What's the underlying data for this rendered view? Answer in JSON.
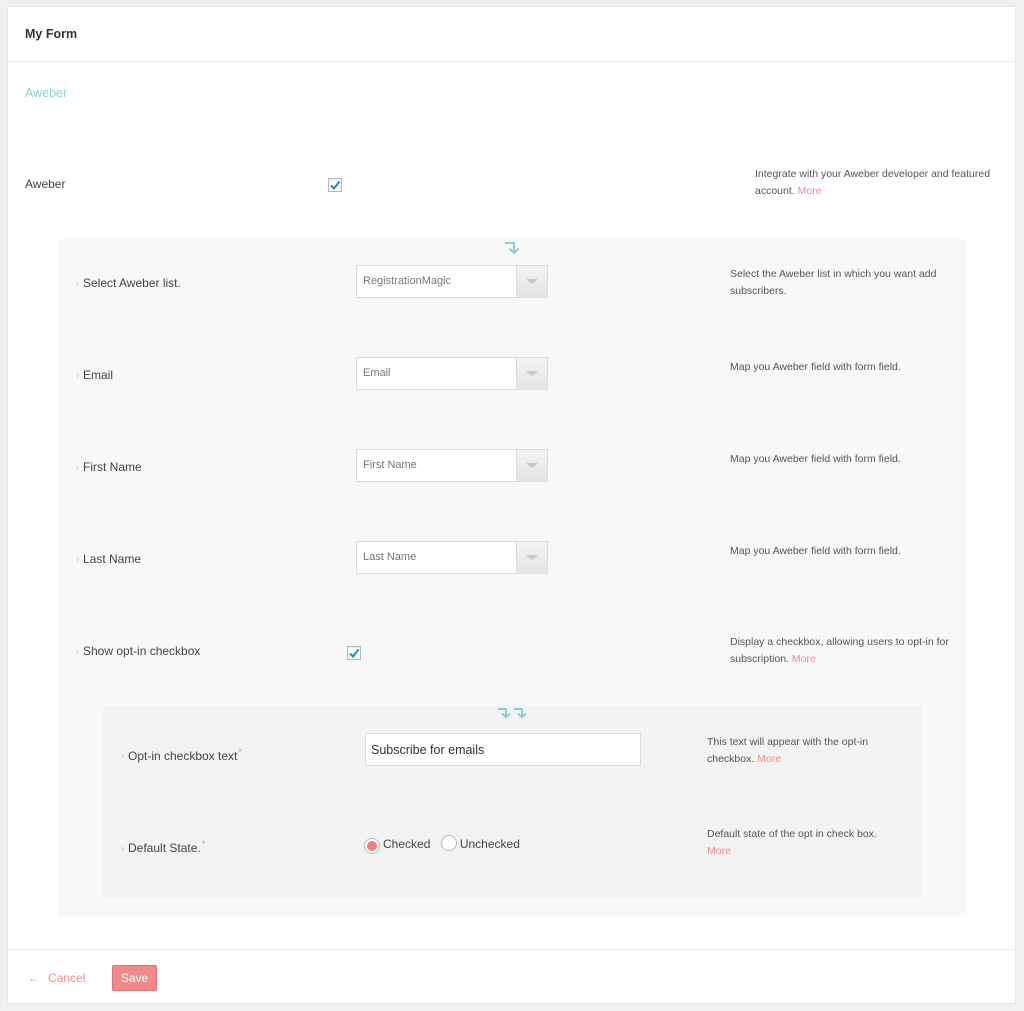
{
  "header": {
    "title": "My Form"
  },
  "section": {
    "title": "Aweber"
  },
  "aweber_toggle": {
    "label": "Aweber",
    "checked": true,
    "help": "Integrate with your Aweber developer and featured account.",
    "more": "More"
  },
  "fields": [
    {
      "label": "Select Aweber list.",
      "value": "RegistrationMagic",
      "help": "Select the Aweber list in which you want add subscribers."
    },
    {
      "label": "Email",
      "value": "Email",
      "help": "Map you Aweber field with form field."
    },
    {
      "label": "First Name",
      "value": "First Name",
      "help": "Map you Aweber field with form field."
    },
    {
      "label": "Last Name",
      "value": "Last Name",
      "help": "Map you Aweber field with form field."
    }
  ],
  "optin": {
    "label": "Show opt-in checkbox",
    "checked": true,
    "help": "Display a checkbox, allowing users to opt-in for subscription.",
    "more": "More"
  },
  "optin_text": {
    "label": "Opt-in checkbox text",
    "required_mark": "*",
    "value": "Subscribe for emails",
    "help": "This text will appear with the opt-in checkbox.",
    "more": "More"
  },
  "default_state": {
    "label": "Default State.",
    "required_mark": "*",
    "options": [
      "Checked",
      "Unchecked"
    ],
    "selected": "Checked",
    "help": "Default state of the opt in check box.",
    "more": "More"
  },
  "footer": {
    "cancel_arrow": "←",
    "cancel_label": "Cancel",
    "save_label": "Save"
  },
  "colors": {
    "accent_teal": "#8fd0cb",
    "accent_red": "#f08a8a"
  }
}
